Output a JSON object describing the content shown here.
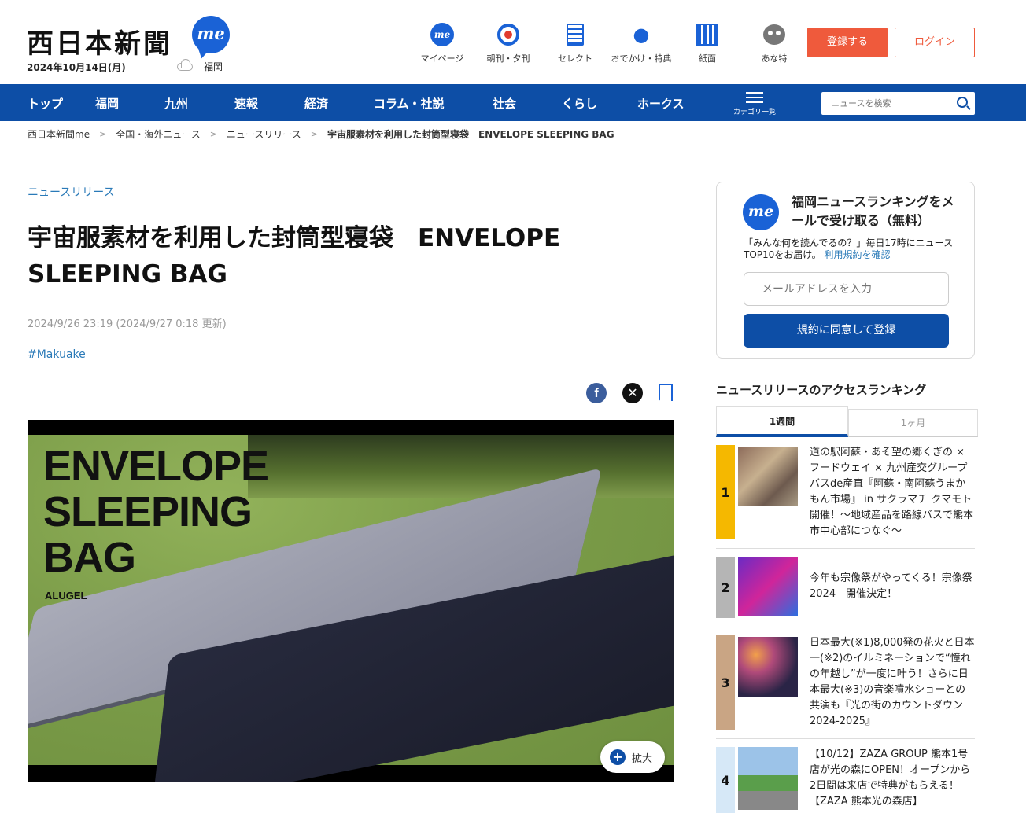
{
  "header": {
    "logo": "西日本新聞",
    "logo_badge": "me",
    "date": "2024年10月14日(月)",
    "weather_location": "福岡",
    "nav": [
      {
        "label": "マイページ",
        "icon": "me-icon"
      },
      {
        "label": "朝刊・夕刊",
        "icon": "target-icon"
      },
      {
        "label": "セレクト",
        "icon": "paper-icon"
      },
      {
        "label": "おでかけ・特典",
        "icon": "footprints-icon"
      },
      {
        "label": "紙面",
        "icon": "newspaper-icon"
      },
      {
        "label": "あな特",
        "icon": "animal-icon"
      }
    ],
    "register_label": "登録する",
    "login_label": "ログイン"
  },
  "navbar": {
    "items": [
      "トップ",
      "福岡",
      "九州",
      "速報",
      "経済",
      "コラム・社説",
      "社会",
      "くらし",
      "ホークス"
    ],
    "category_label": "カテゴリ一覧",
    "search_placeholder": "ニュースを検索"
  },
  "breadcrumb": [
    "西日本新聞me",
    "全国・海外ニュース",
    "ニュースリリース",
    "宇宙服素材を利用した封筒型寝袋　ENVELOPE SLEEPING BAG"
  ],
  "article": {
    "category": "ニュースリリース",
    "title": "宇宙服素材を利用した封筒型寝袋　ENVELOPE SLEEPING BAG",
    "published": "2024/9/26 23:19 (2024/9/27 0:18 更新)",
    "tag": "#Makuake",
    "image_text": "ENVELOPE\nSLEEPING\nBAG",
    "image_brand": "ALUGEL",
    "zoom_label": "拡大"
  },
  "signup": {
    "badge": "me",
    "title": "福岡ニュースランキングをメールで受け取る（無料）",
    "desc": "「みんな何を読んでるの？」毎日17時にニュースTOP10をお届け。",
    "link": "利用規約を確認",
    "email_placeholder": "メールアドレスを入力",
    "button": "規約に同意して登録"
  },
  "ranking": {
    "heading": "ニュースリリースのアクセスランキング",
    "tabs": [
      "1週間",
      "1ヶ月"
    ],
    "items": [
      {
        "rank": "1",
        "color": "#f5b800",
        "text": "道の駅阿蘇・あそ望の郷くぎの × フードウェイ × 九州産交グループバスde産直『阿蘇・南阿蘇うまかもん市場』 in サクラマチ クマモト開催！～地域産品を路線バスで熊本市中心部につなぐ～"
      },
      {
        "rank": "2",
        "color": "#b5b5b5",
        "text": "今年も宗像祭がやってくる！宗像祭2024　開催決定！"
      },
      {
        "rank": "3",
        "color": "#c9a584",
        "text": "日本最大(※1)8,000発の花火と日本一(※2)のイルミネーションで“憧れの年越し”が一度に叶う！さらに日本最大(※3)の音楽噴水ショーとの共演も『光の街のカウントダウン2024-2025』"
      },
      {
        "rank": "4",
        "color": "#d6e8f7",
        "text": "【10/12】ZAZA GROUP 熊本1号店が光の森にOPEN！オープンから2日間は来店で特典がもらえる！【ZAZA 熊本光の森店】"
      }
    ]
  }
}
